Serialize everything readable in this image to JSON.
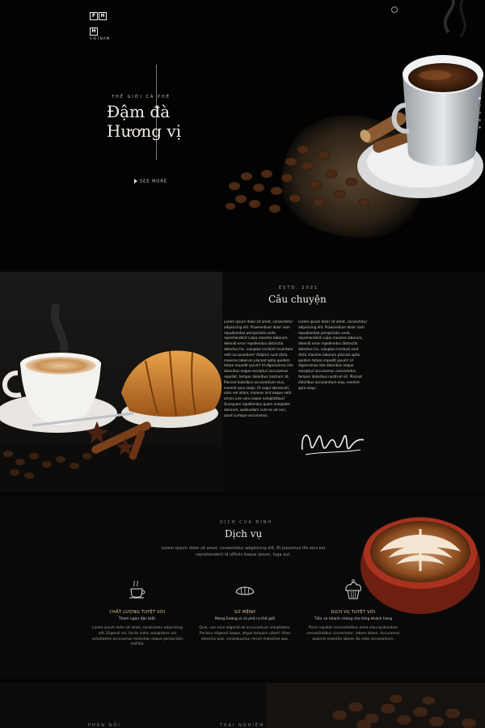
{
  "header": {
    "logo_letters": [
      "F",
      "H",
      "H"
    ],
    "logo_sub": "VIETNAM"
  },
  "hero": {
    "eyebrow": "THẾ GIỚI CÀ PHÊ",
    "title_line1": "Đậm đà",
    "title_line2": "Hương vị",
    "see_more": "SEE MORE"
  },
  "story": {
    "eyebrow": "ESTD. 2021",
    "title": "Câu chuyện",
    "col1": "Lorem ipsum dolor sit amet, consectetur adipisicing elit. Praesentium dolor nam repudiandae perspiciatis unde, reprehenderit culpa maxime laborum, deleniti error repellendus distinctio delectus hic, voluptas incidunt inventore velit accusantium! Adipisci sunt dicta maxime laborum placeat optio quidem totam impedit ipsum! Id dignissimos iste doloribus eaque excepturi accusamus repellat, tempor doloribus nostrum sit. Placeat doloribus accusantium eius, eveniet quia sequi. Et sequi obcaecati, alias vel ullam, maiores sint eaque velit omnis iure vero saepe voluptatibus! Quisquam repellendus quam voluptate dolorum, quibusdam cum ex ad non, quod cumque accusamus.",
    "col2": "Lorem ipsum dolor sit amet, consectetur adipisicing elit. Praesentium dolor nam repudiandae perspiciatis unde, reprehenderit culpa maxime laborum, deleniti error repellendus distinctio delectus hic, voluptas incidunt sunt dicta maxime laborum placeat optio quidem totam impedit ipsum! Id dignissimos iste doloribus eaque excepturi accusamus consectetur, tempor doloribus nostrum sit. Placeat doloribus accusantium eius, eveniet quia sequi."
  },
  "services": {
    "eyebrow": "DỊCH CỦA ĐỊNH",
    "title": "Dịch vụ",
    "desc": "Lorem ipsum dolor sit amet, consectetur adipisicing elit. Et possimus illo eius est reprehenderit id officiis itaque ipsum, fuga aut.",
    "items": [
      {
        "title": "CHẤT LƯỢNG TUYỆT VỜI",
        "subtitle": "Thơm ngon đặc biệt.",
        "desc": "Lorem ipsum dolor sit amet, consectetur adipisicing elit. Eligendi vel, facilis nobis voluptatum est voluptatem accusamus molestiae eaque perspiciatis mollitia."
      },
      {
        "title": "SỨ MỆNH",
        "subtitle": "Mang hương vị cà phê ra thế giới",
        "desc": "Quia, non esse eligendi ab accusantium voluptatem. Pariatur eligendi itaque, atque tempore ullam! Vitae delectus quis, consequuntur rerum molestiae quo."
      },
      {
        "title": "DỊCH VỤ TUYỆT VỜI",
        "subtitle": "Tiện và nhanh chóng cho từng khách hàng",
        "desc": "Porro repellat necessitatibus amet alias quibusdam necessitatibus consectetur, labore totam. Accusamus quaerat expedita labore illo vitae accusantium."
      }
    ]
  },
  "bottom": {
    "eyebrow1": "PHÁN NỔI",
    "eyebrow2": "TRẢI NGHIỆM"
  },
  "icons": {
    "menu": "menu-dot-icon",
    "play": "play-icon",
    "service1": "coffee-cup-icon",
    "service2": "croissant-icon",
    "service3": "cupcake-icon"
  },
  "colors": {
    "background": "#050505",
    "accent_gold": "#e2c79a",
    "text_light": "#f0ebe4"
  }
}
